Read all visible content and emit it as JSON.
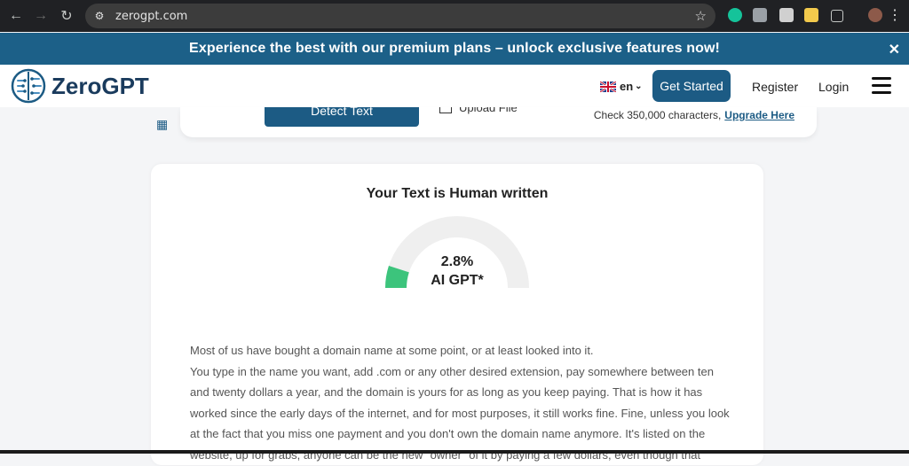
{
  "browser": {
    "url": "zerogpt.com"
  },
  "banner": {
    "text": "Experience the best with our premium plans – unlock exclusive features now!",
    "close": "✕"
  },
  "header": {
    "brand": "ZeroGPT",
    "lang": "en",
    "get_started": "Get Started",
    "register": "Register",
    "login": "Login"
  },
  "topcard": {
    "detect": "Detect Text",
    "upload": "Upload File",
    "check_text": "Check 350,000 characters,",
    "upgrade": "Upgrade Here"
  },
  "result": {
    "title": "Your Text is Human written",
    "percentage": "2.8%",
    "label": "AI GPT*",
    "ai_fraction": 0.028,
    "paragraphs": [
      "Most of us have bought a domain name at some point, or at least looked into it.",
      "You type in the name you want, add .com or any other desired extension, pay somewhere between ten and twenty dollars a year, and the domain is yours for as long as you keep paying. That is how it has worked since the early days of the internet, and for most purposes, it still works fine. Fine, unless you look at the fact that you miss one payment and you don't own the domain name anymore. It's listed on the website, up for grabs, anyone can be the new \"owner\" of it by paying a few dollars, even though that"
    ]
  },
  "colors": {
    "banner": "#1c6088",
    "primary": "#1c5b84",
    "gauge_track": "#efefef",
    "gauge_fill": "#3cc47c"
  }
}
